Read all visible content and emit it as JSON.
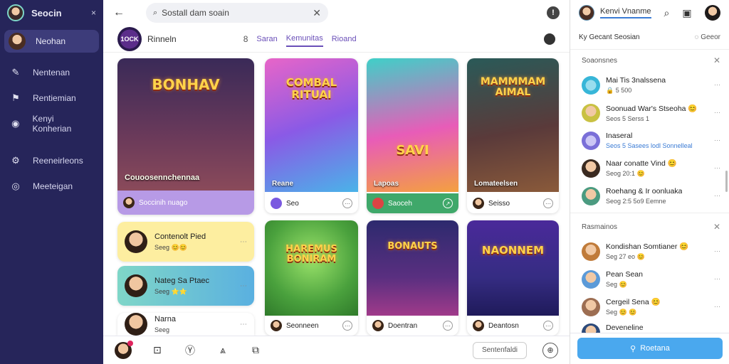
{
  "sidebar": {
    "title": "Seocin",
    "close": "×",
    "user_name": "Neohan",
    "items": [
      {
        "label": "Nentenan",
        "icon": "pencil-icon",
        "glyph": "✎"
      },
      {
        "label": "Rentiemian",
        "icon": "flag-icon",
        "glyph": "⚑"
      },
      {
        "label": "Kenyi Konherian",
        "icon": "globe-icon",
        "glyph": "◉"
      },
      {
        "label": "Reeneirleons",
        "icon": "settings-icon",
        "glyph": "⚙"
      },
      {
        "label": "Meeteigan",
        "icon": "camera-icon",
        "glyph": "◎"
      }
    ]
  },
  "topbar": {
    "back": "←",
    "search_value": "Sostall dam soain",
    "search_icon": "🔍",
    "clear": "✕",
    "info": "!"
  },
  "nav": {
    "logo": "1OCK",
    "brand": "Rinneln",
    "b_icon": "8",
    "tabs": [
      {
        "label": "Saran",
        "active": false
      },
      {
        "label": "Kemunitas",
        "active": true
      },
      {
        "label": "Rioand",
        "active": false
      }
    ]
  },
  "cards": [
    {
      "art": "BONHAV",
      "caption": "Couoosennchennaa",
      "footer": "Soccinih nuago",
      "color": "#b79ae6"
    },
    {
      "art": "COMBAL RITUAI",
      "caption": "Reane",
      "footer": "Seo",
      "color": "#7a59e0"
    },
    {
      "art": "SAVI",
      "caption": "Lapoas",
      "footer": "Saoceh",
      "color": "#3fb5a0"
    },
    {
      "art": "MAMMMAM AIMAL",
      "caption": "Lomateelsen",
      "footer": "Seisso",
      "color": "#5a2f6f"
    },
    {
      "art": "HAREMUS BONIRAM",
      "caption": "",
      "footer": "Seonneen",
      "color": "#4aa13d"
    },
    {
      "art": "BONAUTS",
      "caption": "",
      "footer": "Doentran",
      "color": "#3f2a70"
    },
    {
      "art": "NAONNEM",
      "caption": "",
      "footer": "Deantosn",
      "color": "#352c82"
    }
  ],
  "small_cards": [
    {
      "name": "Contenolt Pied",
      "sub": "Seeg 😊😊",
      "color": "#fff0a8"
    },
    {
      "name": "Nateg Sa Ptaec",
      "sub": "Seeg ⭐⭐",
      "color": "#7fd6c8"
    },
    {
      "name": "Narna",
      "sub": "Seeg",
      "color": "#ffffff"
    }
  ],
  "bottombar": {
    "icons": [
      "square-icon",
      "y-icon",
      "a-icon",
      "crop-icon"
    ],
    "glyphs": [
      "⊡",
      "Ⓨ",
      "⩓",
      "⧉"
    ],
    "button": "Sentenfaldi",
    "round": "⊕"
  },
  "right": {
    "user_name": "Kenvi Vnanme",
    "header_left": "Ky Gecant Seosian",
    "header_right": "Geeor",
    "section1": "Soaonsnes",
    "section2": "Rasmainos",
    "list1": [
      {
        "name": "Mai Tis 3nalssena",
        "sub": "🔒 5 500",
        "color": "#38b6d8"
      },
      {
        "name": "Soonuad War's Stseoha 😊",
        "sub": "Seos 5 Serss 1",
        "color": "#c9c142"
      },
      {
        "name": "Inaseral",
        "sub": "Seos 5 Sasees lodl Sonnelleal",
        "color": "#7a6fd8"
      },
      {
        "name": "Naar conatte Vind 😊",
        "sub": "Seog 20:1 😊",
        "color": "#8f5b3a"
      },
      {
        "name": "Roehang & Ir oonluaka",
        "sub": "Seog 2:5 5o9 Eemne",
        "color": "#4b9b80"
      }
    ],
    "list2": [
      {
        "name": "Kondishan Somtianer 😊",
        "sub": "Seg 27 eo 😊",
        "color": "#c07b3a"
      },
      {
        "name": "Pean Sean",
        "sub": "Seg 😊",
        "color": "#5b9ad8"
      },
      {
        "name": "Cergeil Sena 😊",
        "sub": "Seg 😊 😊",
        "color": "#9d6e52"
      },
      {
        "name": "Deveneline",
        "sub": "",
        "color": "#2c4a7a"
      }
    ],
    "footer_button": "Roetana"
  }
}
